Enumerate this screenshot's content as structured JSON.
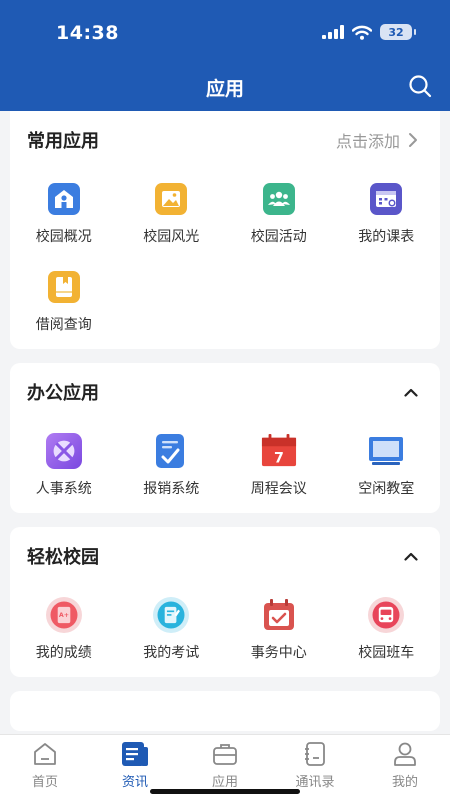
{
  "status": {
    "time": "14:38",
    "battery": "32"
  },
  "header": {
    "title": "应用"
  },
  "sections": {
    "common": {
      "title": "常用应用",
      "action": "点击添加",
      "apps": [
        {
          "label": "校园概况",
          "icon": "school-building-icon"
        },
        {
          "label": "校园风光",
          "icon": "scenery-image-icon"
        },
        {
          "label": "校园活动",
          "icon": "group-activity-icon"
        },
        {
          "label": "我的课表",
          "icon": "timetable-icon"
        },
        {
          "label": "借阅查询",
          "icon": "book-borrow-icon"
        }
      ]
    },
    "office": {
      "title": "办公应用",
      "apps": [
        {
          "label": "人事系统",
          "icon": "personnel-icon"
        },
        {
          "label": "报销系统",
          "icon": "reimbursement-icon"
        },
        {
          "label": "周程会议",
          "icon": "calendar-meeting-icon"
        },
        {
          "label": "空闲教室",
          "icon": "classroom-screen-icon"
        }
      ]
    },
    "easy": {
      "title": "轻松校园",
      "apps": [
        {
          "label": "我的成绩",
          "icon": "grade-icon"
        },
        {
          "label": "我的考试",
          "icon": "exam-icon"
        },
        {
          "label": "事务中心",
          "icon": "affairs-calendar-icon"
        },
        {
          "label": "校园班车",
          "icon": "bus-icon"
        }
      ]
    }
  },
  "tabs": [
    {
      "label": "首页",
      "icon": "home-icon"
    },
    {
      "label": "资讯",
      "icon": "news-icon",
      "active": true
    },
    {
      "label": "应用",
      "icon": "briefcase-icon"
    },
    {
      "label": "通讯录",
      "icon": "contacts-book-icon"
    },
    {
      "label": "我的",
      "icon": "user-icon"
    }
  ],
  "colors": {
    "header": "#1f5ab4",
    "active_tab": "#1f5ab4"
  },
  "calendar_icon_day": "7",
  "grade_icon_text": "A+"
}
